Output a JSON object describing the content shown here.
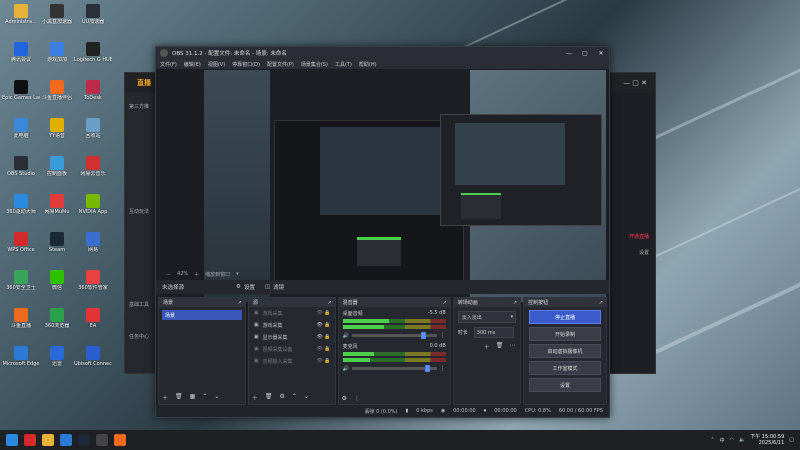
{
  "desktop": {
    "icons": [
      {
        "label": "Administra...",
        "color": "#e8b23a"
      },
      {
        "label": "小黑盒加速器",
        "color": "#333333"
      },
      {
        "label": "UU加速器",
        "color": "#2a2f3a"
      },
      {
        "label": "腾讯会议",
        "color": "#2266dd"
      },
      {
        "label": "游戏加加",
        "color": "#3b7fe0"
      },
      {
        "label": "Logitech G HUB",
        "color": "#222"
      },
      {
        "label": "Epic Games Launcher",
        "color": "#111"
      },
      {
        "label": "斗鱼直播伴侣",
        "color": "#f06a1d"
      },
      {
        "label": "ToDesk",
        "color": "#c02a4a"
      },
      {
        "label": "此电脑",
        "color": "#3a89d8"
      },
      {
        "label": "YY语音",
        "color": "#e0b000"
      },
      {
        "label": "回收站",
        "color": "#6aa0c8"
      },
      {
        "label": "OBS Studio",
        "color": "#2a2d33"
      },
      {
        "label": "控制面板",
        "color": "#3b9ad8"
      },
      {
        "label": "网易云音乐",
        "color": "#d03030"
      },
      {
        "label": "360驱动大师",
        "color": "#2a8ae0"
      },
      {
        "label": "网易MuMu",
        "color": "#e03a3a"
      },
      {
        "label": "NVIDIA App",
        "color": "#76b900"
      },
      {
        "label": "WPS Office",
        "color": "#d32a2a"
      },
      {
        "label": "Steam",
        "color": "#1b2838"
      },
      {
        "label": "网易",
        "color": "#3a6fd0"
      },
      {
        "label": "360安全卫士",
        "color": "#3aa35a"
      },
      {
        "label": "微信",
        "color": "#2dc100"
      },
      {
        "label": "360软件管家",
        "color": "#e94040"
      },
      {
        "label": "斗鱼直播",
        "color": "#f06a1d"
      },
      {
        "label": "360浏览器",
        "color": "#2aa04a"
      },
      {
        "label": "EA",
        "color": "#e23434"
      },
      {
        "label": "Microsoft Edge",
        "color": "#2a7ad6"
      },
      {
        "label": "迅雷",
        "color": "#2a6ad6"
      },
      {
        "label": "Ubisoft Connect",
        "color": "#2a5fd0"
      }
    ]
  },
  "bg_app": {
    "title": "直播",
    "side_labels": [
      "第三方推",
      "互动玩法",
      "基础工具",
      "任务中心"
    ],
    "right_text": "开通直播",
    "right_text2": "设置"
  },
  "obs": {
    "title": "OBS 31.1.2 - 配置文件: 未命名 - 场景: 未命名",
    "menu": [
      "文件(F)",
      "编辑(E)",
      "视图(V)",
      "停靠窗口(D)",
      "配置文件(P)",
      "场景集合(S)",
      "工具(T)",
      "帮助(H)"
    ],
    "scene_bar": {
      "label": "未选择源",
      "props": "设置",
      "filters": "滤镜"
    },
    "zoom": "42%",
    "zoom_text": "缩放到窗口",
    "docks": {
      "scenes": {
        "title": "场景",
        "items": [
          "场景"
        ]
      },
      "sources": {
        "title": "源",
        "items": [
          {
            "label": "游戏采集",
            "dim": true
          },
          {
            "label": "游戏采集",
            "dim": false
          },
          {
            "label": "显示器采集",
            "dim": false
          },
          {
            "label": "视频采集设备",
            "dim": true
          },
          {
            "label": "音频输入采集",
            "dim": true
          }
        ]
      },
      "mixer": {
        "title": "混音器",
        "tracks": [
          {
            "name": "桌面音频",
            "db": "-5.5 dB",
            "level": 0.45,
            "volume": 0.85
          },
          {
            "name": "麦克风",
            "db": "0.0 dB",
            "level": 0.3,
            "volume": 0.9
          }
        ]
      },
      "transitions": {
        "title": "转场动画",
        "selected": "淡入淡出",
        "duration_label": "时长",
        "duration": "300 ms"
      },
      "controls": {
        "title": "控制按钮",
        "buttons": [
          {
            "label": "停止直播",
            "active": true
          },
          {
            "label": "开始录制",
            "active": false
          },
          {
            "label": "启动虚拟摄像机",
            "active": false
          },
          {
            "label": "工作室模式",
            "active": false
          },
          {
            "label": "设置",
            "active": false
          }
        ]
      }
    },
    "status": {
      "dropped": "丢帧 0 (0.0%)",
      "kbps": "0 kbps",
      "stream_time": "00:00:00",
      "rec_time": "00:00:00",
      "cpu": "CPU: 0.8%",
      "fps": "60.00 / 60.00 FPS"
    }
  },
  "taskbar": {
    "apps": [
      {
        "name": "windows",
        "color": "#2a8ae0"
      },
      {
        "name": "wps",
        "color": "#d32a2a"
      },
      {
        "name": "explorer",
        "color": "#e8b23a"
      },
      {
        "name": "edge",
        "color": "#2a7ad6"
      },
      {
        "name": "steam",
        "color": "#1b2838"
      },
      {
        "name": "obs",
        "color": "#444"
      },
      {
        "name": "douyu",
        "color": "#f06a1d"
      }
    ],
    "ime": "中",
    "time": "下午 15:00:59",
    "date": "2025/6/11"
  }
}
